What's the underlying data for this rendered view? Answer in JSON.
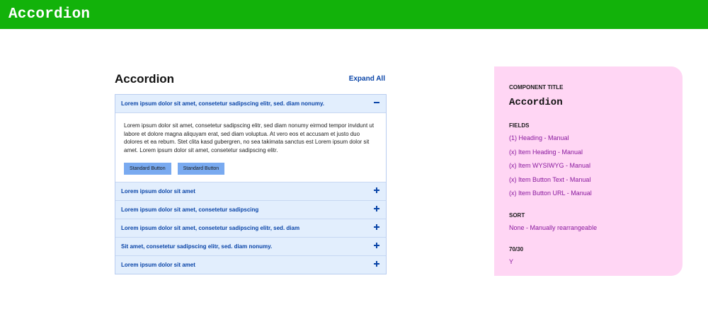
{
  "header": {
    "title": "Accordion"
  },
  "accordion": {
    "heading": "Accordion",
    "expand_all_label": "Expand All",
    "items": [
      {
        "title": "Lorem ipsum dolor sit amet, consetetur sadipscing elitr, sed. diam nonumy.",
        "expanded": true,
        "body": "Lorem ipsum dolor sit amet, consetetur sadipscing elitr, sed diam nonumy eirmod tempor invidunt ut labore et dolore magna aliquyam erat, sed diam voluptua. At vero eos et accusam et justo duo dolores et ea rebum. Stet clita kasd gubergren, no sea takimata sanctus est Lorem ipsum dolor sit amet. Lorem ipsum dolor sit amet, consetetur sadipscing elitr.",
        "buttons": [
          "Standard Button",
          "Standard Button"
        ]
      },
      {
        "title": "Lorem ipsum dolor sit amet",
        "expanded": false
      },
      {
        "title": "Lorem ipsum dolor sit amet, consetetur sadipscing",
        "expanded": false
      },
      {
        "title": "Lorem ipsum dolor sit amet, consetetur sadipscing elitr, sed. diam",
        "expanded": false
      },
      {
        "title": "Sit amet, consetetur sadipscing elitr, sed. diam nonumy.",
        "expanded": false
      },
      {
        "title": "Lorem ipsum dolor sit amet",
        "expanded": false
      }
    ]
  },
  "info": {
    "component_title_label": "COMPONENT TITLE",
    "component_title": "Accordion",
    "fields_label": "FIELDS",
    "fields": [
      "(1) Heading - Manual",
      "(x) Item Heading - Manual",
      "(x) Item WYSIWYG - Manual",
      "(x) Item Button Text - Manual",
      "(x) Item Button URL - Manual"
    ],
    "sort_label": "SORT",
    "sort_value": "None - Manually rearrangeable",
    "ratio_label": "70/30",
    "ratio_value": "Y"
  },
  "colors": {
    "topbar": "#12b20a",
    "accent_blue": "#0a45a8",
    "item_bg": "#e2eefd",
    "button_bg": "#79aaf0",
    "panel_bg": "#ffd6f4",
    "panel_text": "#8a1a9e"
  }
}
